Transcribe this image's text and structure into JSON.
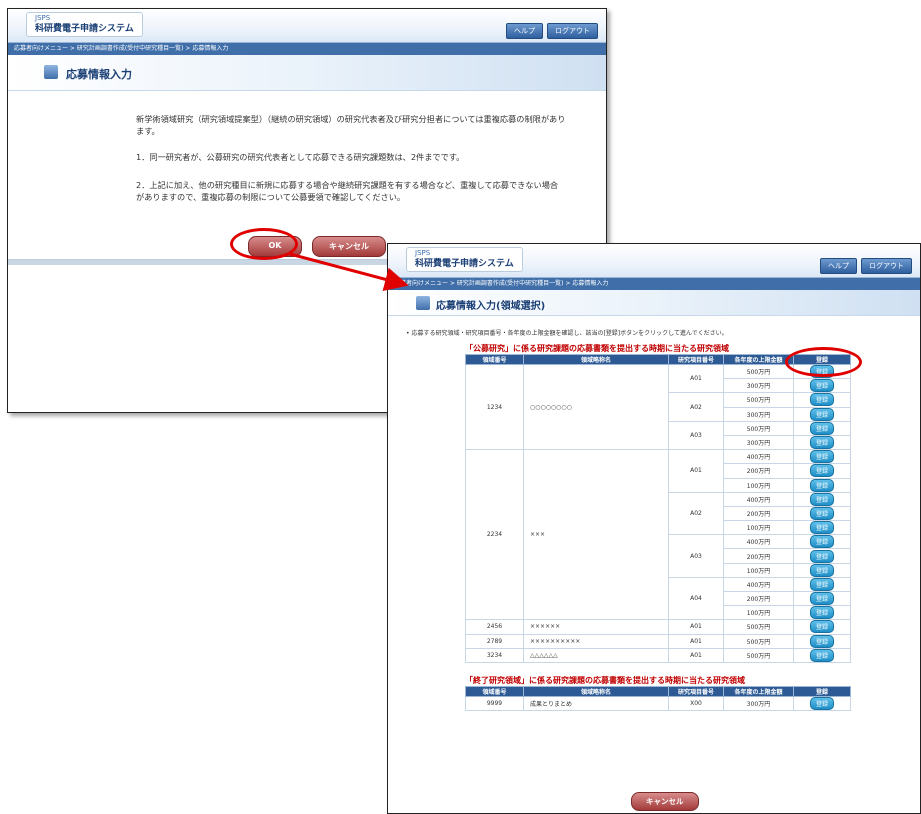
{
  "app": {
    "jsps": "JSPS",
    "system_name": "科研費電子申請システム",
    "help": "ヘルプ",
    "logout": "ログアウト"
  },
  "win1": {
    "breadcrumb": "応募者向けメニュー > 研究計画調書作成(受付中研究種目一覧) > 応募情報入力",
    "title": "応募情報入力",
    "messages": [
      "新学術領域研究（研究領域提案型）（継続の研究領域）の研究代表者及び研究分担者については重複応募の制限があります。",
      "1．同一研究者が、公募研究の研究代表者として応募できる研究課題数は、2件までです。",
      "2．上記に加え、他の研究種目に新規に応募する場合や継続研究課題を有する場合など、重複して応募できない場合がありますので、重複応募の制限について公募要領で確認してください。"
    ],
    "ok_label": "OK",
    "cancel_label": "キャンセル"
  },
  "win2": {
    "breadcrumb": "応募者向けメニュー > 研究計画調書作成(受付中研究種目一覧) > 応募情報入力",
    "title": "応募情報入力(領域選択)",
    "instruction": "応募する研究領域・研究項目番号・各年度の上限金額を確認し、該当の[登録]ボタンをクリックして進んでください。",
    "section1_title": "「公募研究」に係る研究課題の応募書類を提出する時期に当たる研究領域",
    "section2_title": "「終了研究領域」に係る研究課題の応募書類を提出する時期に当たる研究領域",
    "columns": [
      "領域番号",
      "領域略称名",
      "研究項目番号",
      "各年度の上限金額",
      "登録"
    ],
    "register_label": "登録",
    "cancel_label": "キャンセル",
    "areas": [
      {
        "no": "1234",
        "name": "○○○○○○○○",
        "items": [
          {
            "code": "A01",
            "amounts": [
              "500万円",
              "300万円"
            ]
          },
          {
            "code": "A02",
            "amounts": [
              "500万円",
              "300万円"
            ]
          },
          {
            "code": "A03",
            "amounts": [
              "500万円",
              "300万円"
            ]
          }
        ]
      },
      {
        "no": "2234",
        "name": "×××",
        "items": [
          {
            "code": "A01",
            "amounts": [
              "400万円",
              "200万円",
              "100万円"
            ]
          },
          {
            "code": "A02",
            "amounts": [
              "400万円",
              "200万円",
              "100万円"
            ]
          },
          {
            "code": "A03",
            "amounts": [
              "400万円",
              "200万円",
              "100万円"
            ]
          },
          {
            "code": "A04",
            "amounts": [
              "400万円",
              "200万円",
              "100万円"
            ]
          }
        ]
      },
      {
        "no": "2456",
        "name": "××××××",
        "items": [
          {
            "code": "A01",
            "amounts": [
              "500万円"
            ]
          }
        ]
      },
      {
        "no": "2789",
        "name": "××××××××××",
        "items": [
          {
            "code": "A01",
            "amounts": [
              "500万円"
            ]
          }
        ]
      },
      {
        "no": "3234",
        "name": "△△△△△△",
        "items": [
          {
            "code": "A01",
            "amounts": [
              "500万円"
            ]
          }
        ]
      }
    ],
    "ended_areas": [
      {
        "no": "9999",
        "name": "成果とりまとめ",
        "code": "X00",
        "amount": "300万円"
      }
    ]
  }
}
